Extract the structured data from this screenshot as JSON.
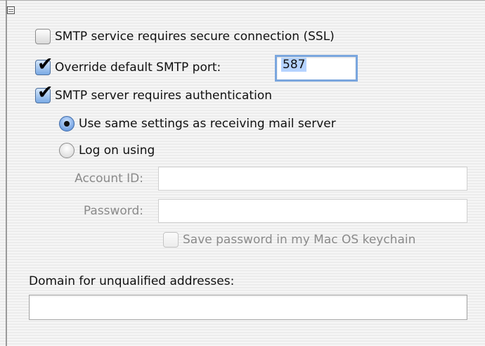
{
  "ssl": {
    "label": "SMTP service requires secure connection (SSL)",
    "checked": false
  },
  "override_port": {
    "label": "Override default SMTP port:",
    "checked": true,
    "port_value": "587"
  },
  "auth": {
    "label": "SMTP server requires authentication",
    "checked": true
  },
  "auth_mode": {
    "same_settings_label": "Use same settings as receiving mail server",
    "logon_label": "Log on using",
    "selected": "same_settings"
  },
  "account_id": {
    "label": "Account ID:",
    "value": ""
  },
  "password": {
    "label": "Password:",
    "value": ""
  },
  "keychain": {
    "label": "Save password in my Mac OS keychain",
    "checked": false,
    "disabled": true
  },
  "domain": {
    "label": "Domain for unqualified addresses:",
    "value": ""
  },
  "colors": {
    "accent": "#4f87d6",
    "selection": "#b5d3ff"
  }
}
